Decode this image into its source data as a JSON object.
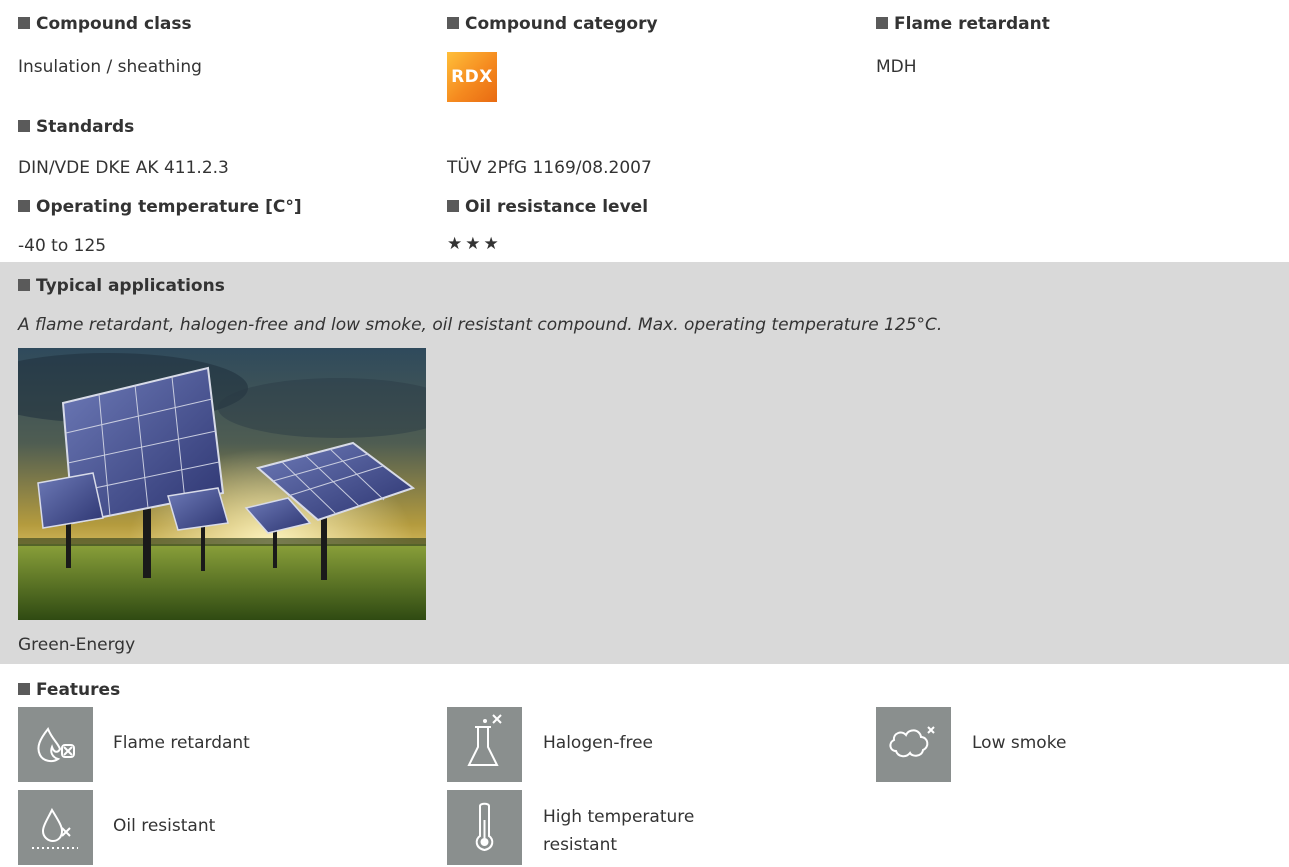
{
  "compound_class": {
    "label": "Compound class",
    "value": "Insulation / sheathing"
  },
  "compound_category": {
    "label": "Compound category",
    "badge": "RDX"
  },
  "flame_retardant": {
    "label": "Flame retardant",
    "value": "MDH"
  },
  "standards": {
    "label": "Standards",
    "items": [
      "DIN/VDE DKE AK 411.2.3",
      "TÜV 2PfG 1169/08.2007"
    ]
  },
  "operating_temperature": {
    "label": "Operating temperature [C°]",
    "value": "-40 to 125"
  },
  "oil_resistance": {
    "label": "Oil resistance level",
    "stars": "★★★",
    "rating": 3
  },
  "typical_applications": {
    "label": "Typical applications",
    "description": "A flame retardant, halogen-free and low smoke, oil resistant compound. Max. operating temperature 125°C.",
    "image_caption": "Green-Energy"
  },
  "features": {
    "label": "Features",
    "items": [
      {
        "label": "Flame retardant",
        "icon": "flame-icon"
      },
      {
        "label": "Halogen-free",
        "icon": "flask-icon"
      },
      {
        "label": "Low smoke",
        "icon": "cloud-icon"
      },
      {
        "label": "Oil resistant",
        "icon": "oil-drop-icon"
      },
      {
        "label": "High temperature resistant",
        "icon": "thermometer-icon"
      }
    ]
  },
  "colors": {
    "header_square": "#5a5a5a",
    "apps_bg": "#d9d9d9",
    "icon_bg": "#8a8f8e",
    "badge": "#f58a1f"
  }
}
